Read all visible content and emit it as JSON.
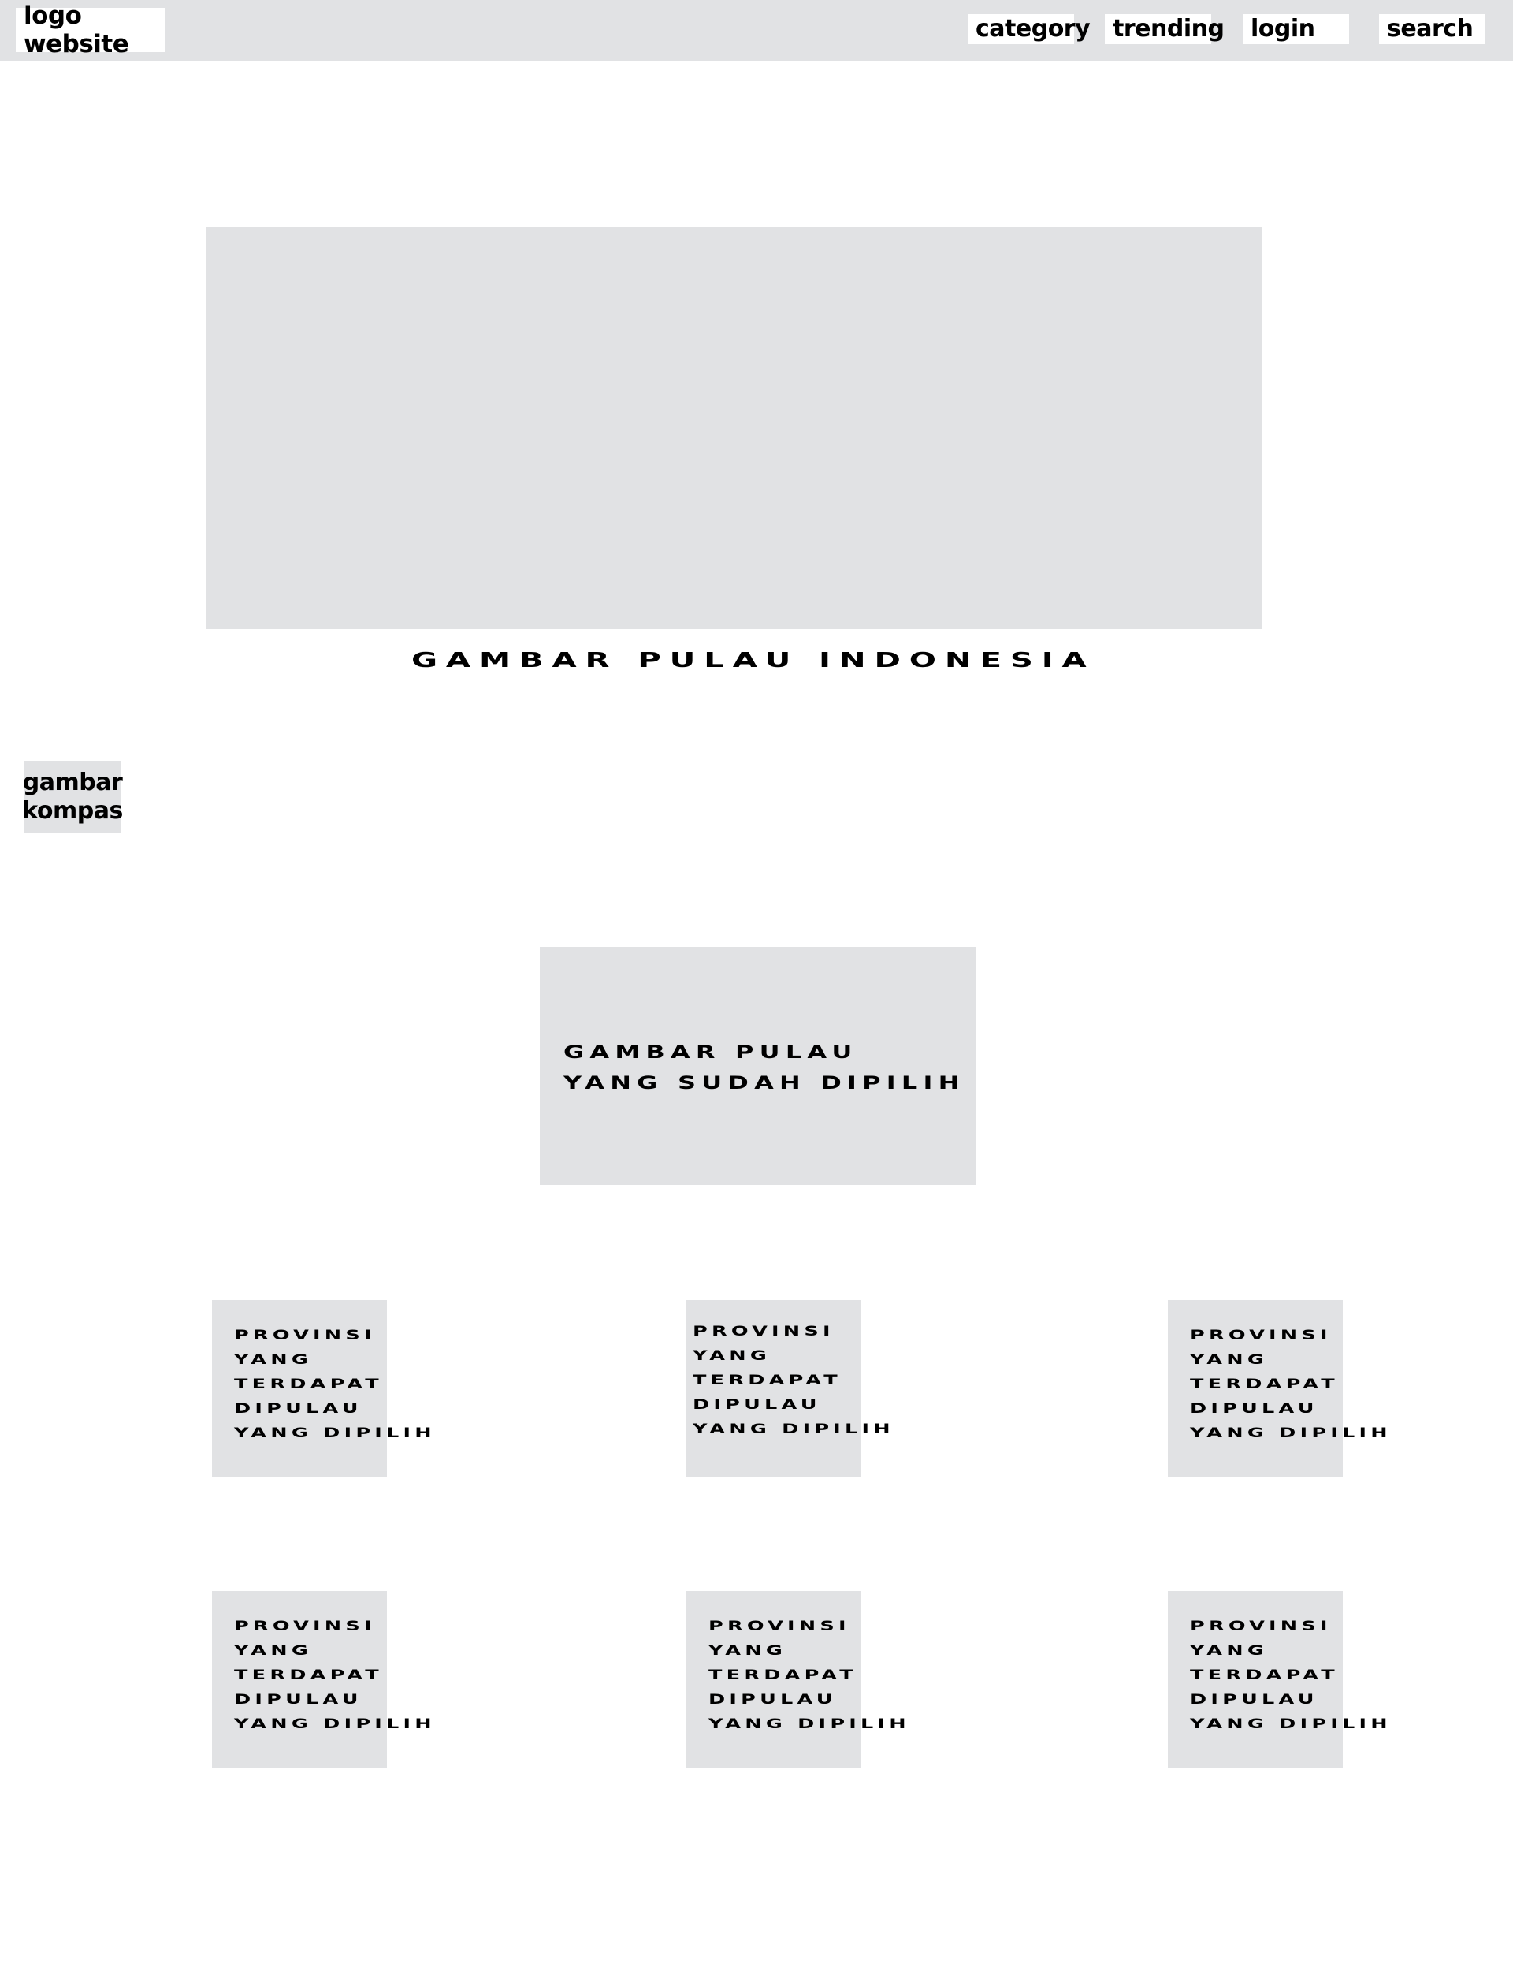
{
  "header": {
    "logo_label": "logo website",
    "nav": {
      "category": "category",
      "trending": "trending",
      "login": "login",
      "search": "search"
    }
  },
  "hero": {
    "caption": "GAMBAR PULAU INDONESIA"
  },
  "compass": {
    "caption": "gambar\nkompas"
  },
  "selected_island": {
    "caption": "GAMBAR PULAU\nYANG SUDAH DIPILIH"
  },
  "provinces": [
    {
      "caption": "PROVINSI\nYANG\nTERDAPAT\nDIPULAU\nYANG DIPILIH"
    },
    {
      "caption": "PROVINSI\nYANG\nTERDAPAT\nDIPULAU\nYANG DIPILIH"
    },
    {
      "caption": "PROVINSI\nYANG\nTERDAPAT\nDIPULAU\nYANG DIPILIH"
    },
    {
      "caption": "PROVINSI\nYANG\nTERDAPAT\nDIPULAU\nYANG DIPILIH"
    },
    {
      "caption": "PROVINSI\nYANG\nTERDAPAT\nDIPULAU\nYANG DIPILIH"
    },
    {
      "caption": "PROVINSI\nYANG\nTERDAPAT\nDIPULAU\nYANG DIPILIH"
    }
  ],
  "colors": {
    "placeholder_gray": "#e1e2e4",
    "background": "#ffffff",
    "text": "#000000"
  }
}
